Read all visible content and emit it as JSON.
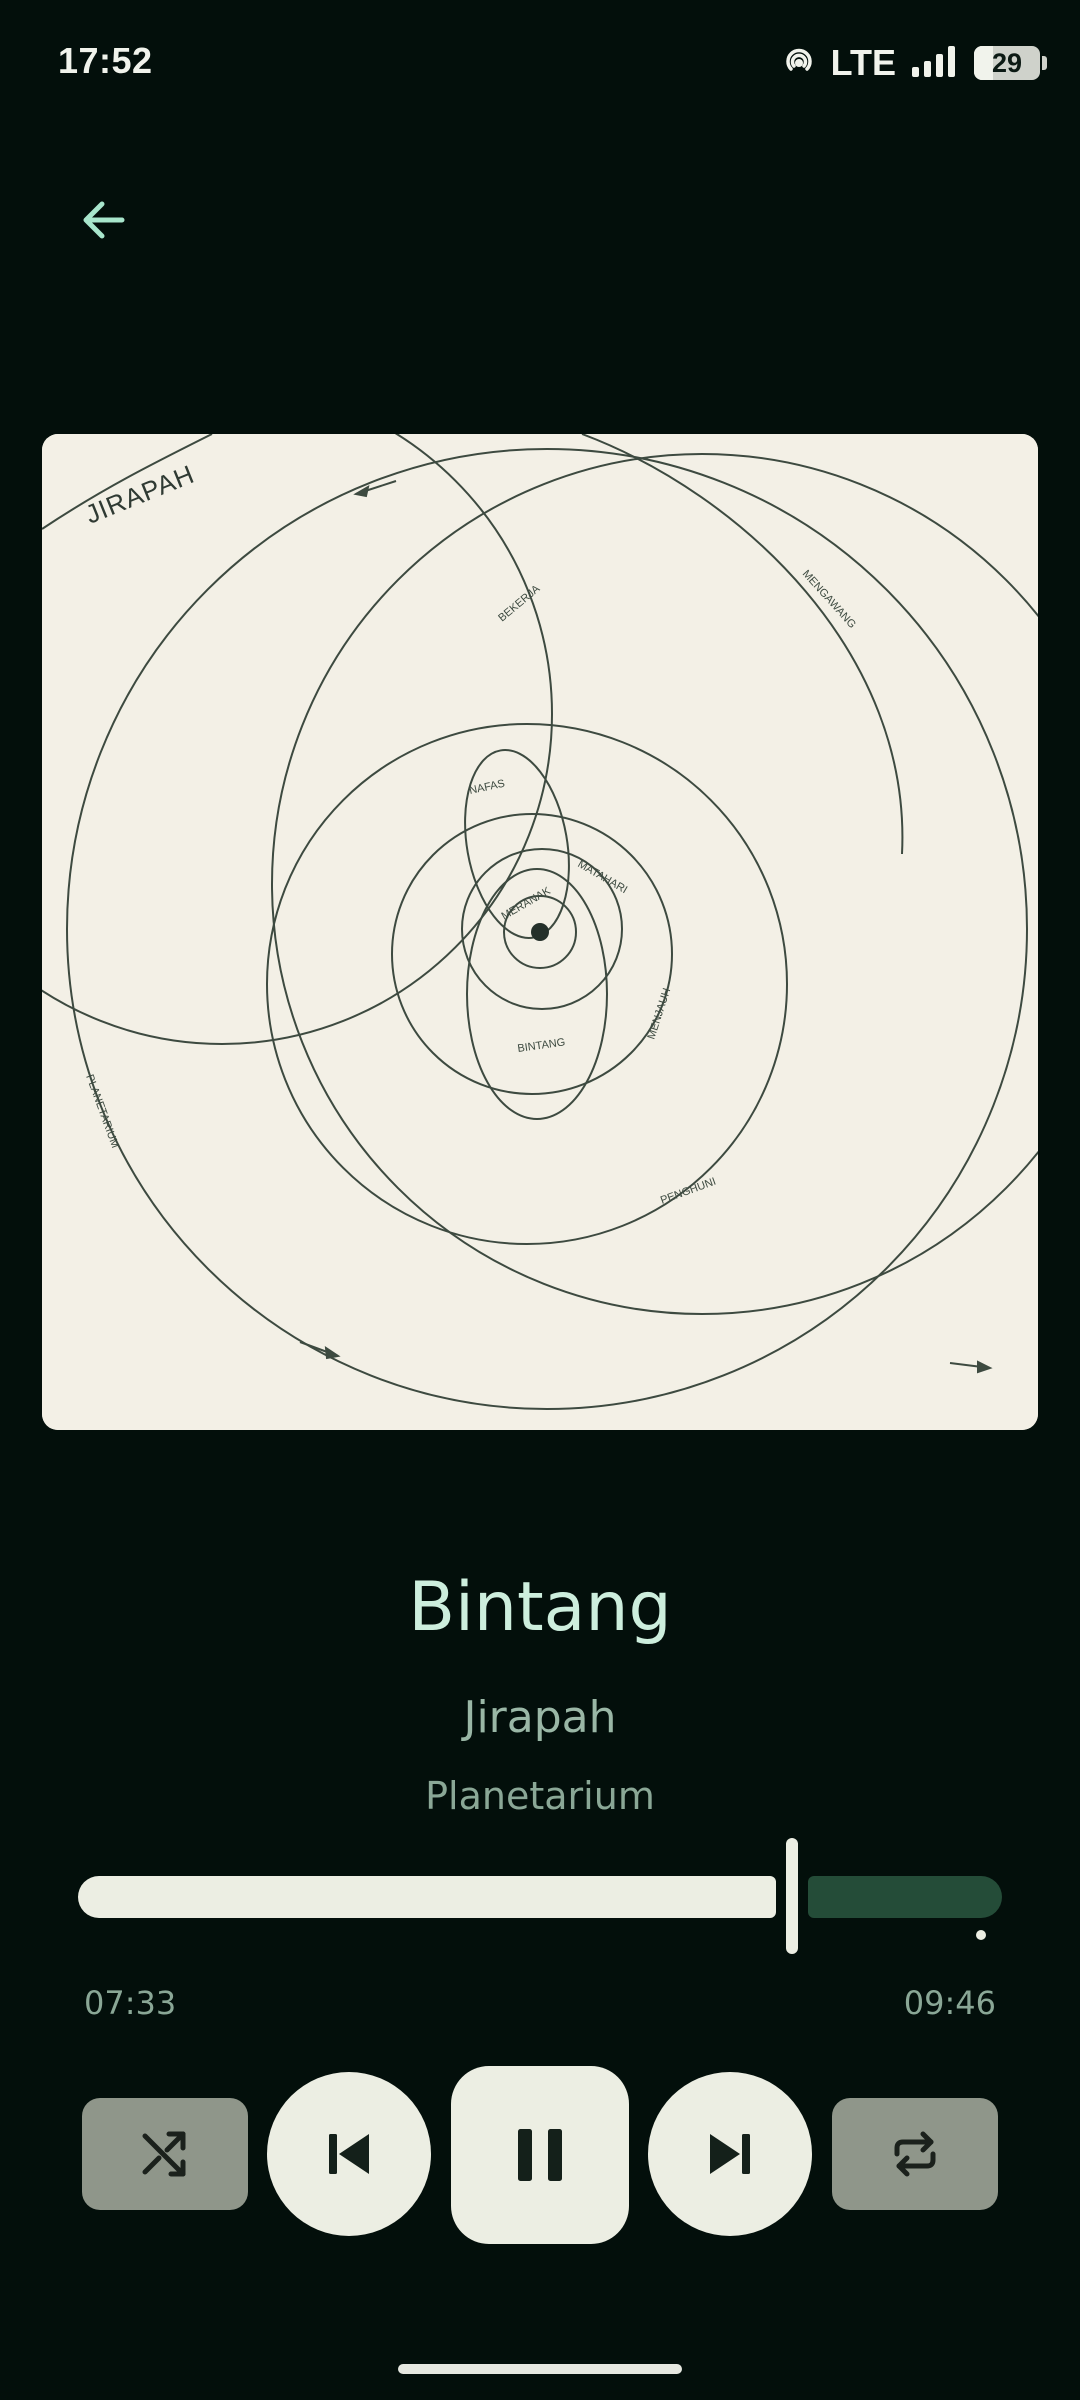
{
  "status_bar": {
    "time": "17:52",
    "network": "LTE",
    "battery": "29",
    "icons": [
      "hotspot-icon",
      "signal-icon",
      "battery-icon"
    ]
  },
  "nav": {
    "back_icon": "arrow-left-icon"
  },
  "artwork": {
    "band_label": "JIRAPAH",
    "orbit_labels": [
      "BEKERJA",
      "MENGAWANG",
      "NAFAS",
      "MATAHARI",
      "MERANAK",
      "BINTANG",
      "MENJAUH",
      "PENGHUNI",
      "PLANETARIUM"
    ]
  },
  "track": {
    "title": "Bintang",
    "artist": "Jirapah",
    "album": "Planetarium"
  },
  "progress": {
    "elapsed": "07:33",
    "total": "09:46",
    "fraction": 0.773
  },
  "controls": {
    "shuffle_icon": "shuffle-icon",
    "previous_icon": "skip-previous-icon",
    "pause_icon": "pause-icon",
    "next_icon": "skip-next-icon",
    "repeat_icon": "repeat-icon"
  },
  "colors": {
    "background": "#030f0b",
    "accent_text": "#cdeedd",
    "secondary_text": "#9ab7a6",
    "button_light": "#eceee3",
    "button_muted": "#8f968a",
    "seek_remaining": "#244c38"
  }
}
